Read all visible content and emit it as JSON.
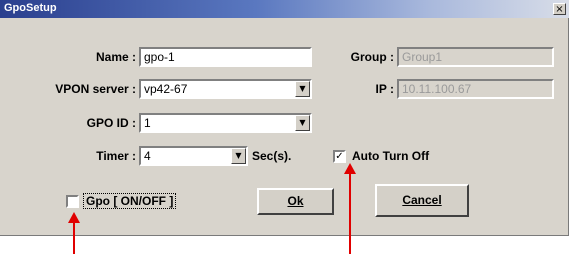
{
  "window": {
    "title": "GpoSetup",
    "close_glyph": "×"
  },
  "form": {
    "name": {
      "label": "Name :",
      "value": "gpo-1"
    },
    "group": {
      "label": "Group :",
      "value": "Group1"
    },
    "vpon_server": {
      "label": "VPON server :",
      "value": "vp42-67"
    },
    "ip": {
      "label": "IP :",
      "value": "10.11.100.67"
    },
    "gpo_id": {
      "label": "GPO ID :",
      "value": "1"
    },
    "timer": {
      "label": "Timer :",
      "value": "4",
      "unit": "Sec(s)."
    },
    "auto_turn_off": {
      "label": "Auto Turn Off",
      "checked": true,
      "mark": "✓"
    },
    "gpo_on_off": {
      "label": "Gpo [ ON/OFF ]",
      "checked": false
    }
  },
  "buttons": {
    "ok": "Ok",
    "cancel": "Cancel"
  },
  "icons": {
    "combo_arrow": "chevron-down-icon",
    "close": "close-icon"
  },
  "colors": {
    "annotation_arrow": "#e00000",
    "title_bar": "#2a3f8e"
  }
}
